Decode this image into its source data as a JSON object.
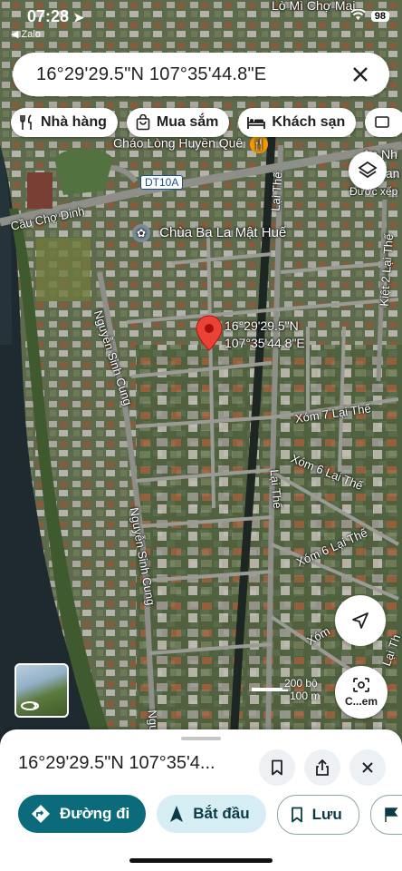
{
  "status_bar": {
    "time": "07:28",
    "back_app": "◀ Zalo",
    "battery": "98",
    "top_place": "Lò Mì Chợ Mai"
  },
  "search": {
    "query": "16°29'29.5\"N 107°35'44.8\"E"
  },
  "chips": [
    {
      "label": "Nhà hàng",
      "icon": "fork-knife-icon"
    },
    {
      "label": "Mua sắm",
      "icon": "shopping-bag-icon"
    },
    {
      "label": "Khách sạn",
      "icon": "bed-icon"
    }
  ],
  "map": {
    "places": {
      "chao_long": "Cháo Lòng Huyền Quê",
      "chua": "Chùa Ba La Mật Huế",
      "an_nhien": "An Nh",
      "an_nhien_2": "tan",
      "duoc_xep": "Được xếp"
    },
    "roads": {
      "dt10a": "DT10A",
      "cau_cho_dinh": "Cầu Chợ Dinh",
      "lai_the_1": "Lại Thế",
      "lai_the_2": "Lại Thế",
      "kiet2": "Kiệt 2 Lại Thế",
      "nguyen_sinh_cung_1": "Nguyễn Sinh Cung",
      "nguyen_sinh_cung_2": "Nguyễn Sinh Cung",
      "nguyen_sinh_cung_3": "Ngu",
      "xom7": "Xóm 7 Lại Thế",
      "xom6a": "Xóm 6 Lại Thế",
      "xom6b": "Xóm 6 Lại Thế",
      "xom_c": "Xóm",
      "lai_the_3": "Lại Th"
    },
    "pin": {
      "line1": "16°29'29.5\"N",
      "line2": "107°35'44.8\"E"
    },
    "scale": {
      "ft": "200 bộ",
      "m": "100 m"
    },
    "lens_label": "C...em",
    "colors": {
      "pin": "#ea4335",
      "river": "#1e2a2f",
      "vegetation": "#3f5a2e"
    }
  },
  "sheet": {
    "title": "16°29'29.5\"N 107°35'4...",
    "buttons": {
      "directions": "Đường đi",
      "start": "Bắt đầu",
      "save": "Lưu"
    }
  }
}
